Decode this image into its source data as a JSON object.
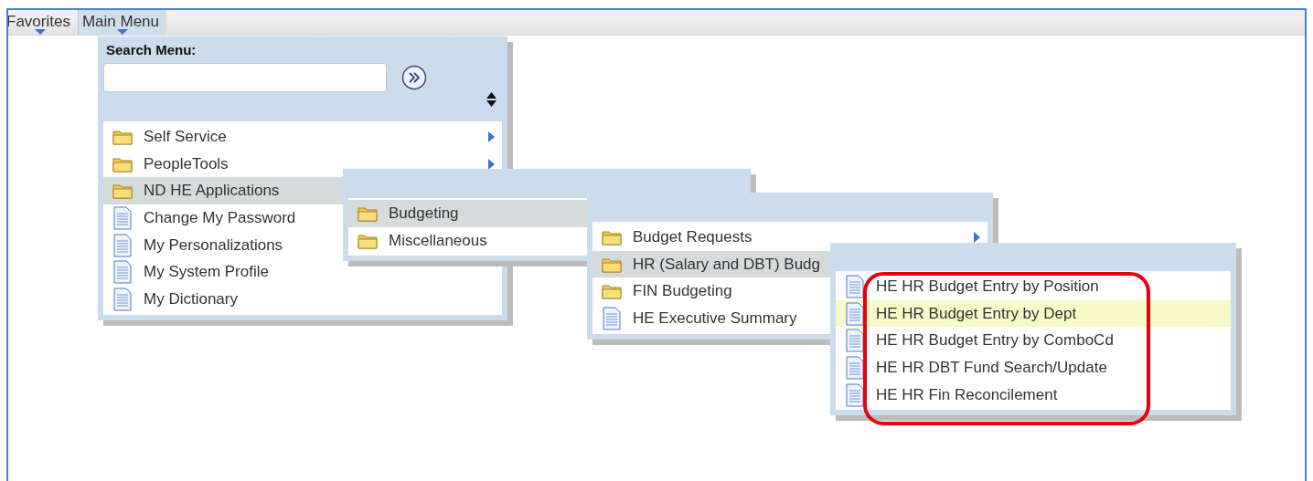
{
  "toolbar": {
    "menus": [
      {
        "label": "Favorites",
        "selected": false
      },
      {
        "label": "Main Menu",
        "selected": true
      }
    ]
  },
  "main_menu": {
    "search_label": "Search Menu:",
    "items": [
      {
        "label": "Self Service",
        "kind": "folder",
        "submenu": true,
        "selected": false,
        "hovered": false
      },
      {
        "label": "PeopleTools",
        "kind": "folder",
        "submenu": true,
        "selected": false,
        "hovered": false
      },
      {
        "label": "ND HE Applications",
        "kind": "folder",
        "selected": true,
        "hovered": false
      },
      {
        "label": "Change My Password",
        "kind": "page",
        "selected": false,
        "hovered": false
      },
      {
        "label": "My Personalizations",
        "kind": "page",
        "selected": false,
        "hovered": false
      },
      {
        "label": "My System Profile",
        "kind": "page",
        "selected": false,
        "hovered": false
      },
      {
        "label": "My Dictionary",
        "kind": "page",
        "selected": false,
        "hovered": false
      }
    ]
  },
  "submenus": [
    {
      "items": [
        {
          "label": "Budgeting",
          "kind": "folder",
          "selected": true,
          "hovered": false
        },
        {
          "label": "Miscellaneous",
          "kind": "folder",
          "selected": false,
          "hovered": false
        }
      ]
    },
    {
      "items": [
        {
          "label": "Budget Requests",
          "kind": "folder",
          "submenu": true,
          "selected": false,
          "hovered": false
        },
        {
          "label": "HR (Salary and DBT) Budg",
          "kind": "folder",
          "selected": true,
          "hovered": false
        },
        {
          "label": "FIN Budgeting",
          "kind": "folder",
          "selected": false,
          "hovered": false
        },
        {
          "label": "HE Executive Summary",
          "kind": "page",
          "selected": false,
          "hovered": false
        }
      ]
    },
    {
      "items": [
        {
          "label": "HE HR Budget Entry by Position",
          "kind": "page",
          "selected": false,
          "hovered": false
        },
        {
          "label": "HE HR Budget Entry by Dept",
          "kind": "page",
          "selected": false,
          "hovered": true
        },
        {
          "label": "HE HR Budget Entry by ComboCd",
          "kind": "page",
          "selected": false,
          "hovered": false
        },
        {
          "label": "HE HR DBT Fund Search/Update",
          "kind": "page",
          "selected": false,
          "hovered": false
        },
        {
          "label": "HE HR Fin Reconcilement",
          "kind": "page",
          "selected": false,
          "hovered": false
        }
      ]
    }
  ]
}
